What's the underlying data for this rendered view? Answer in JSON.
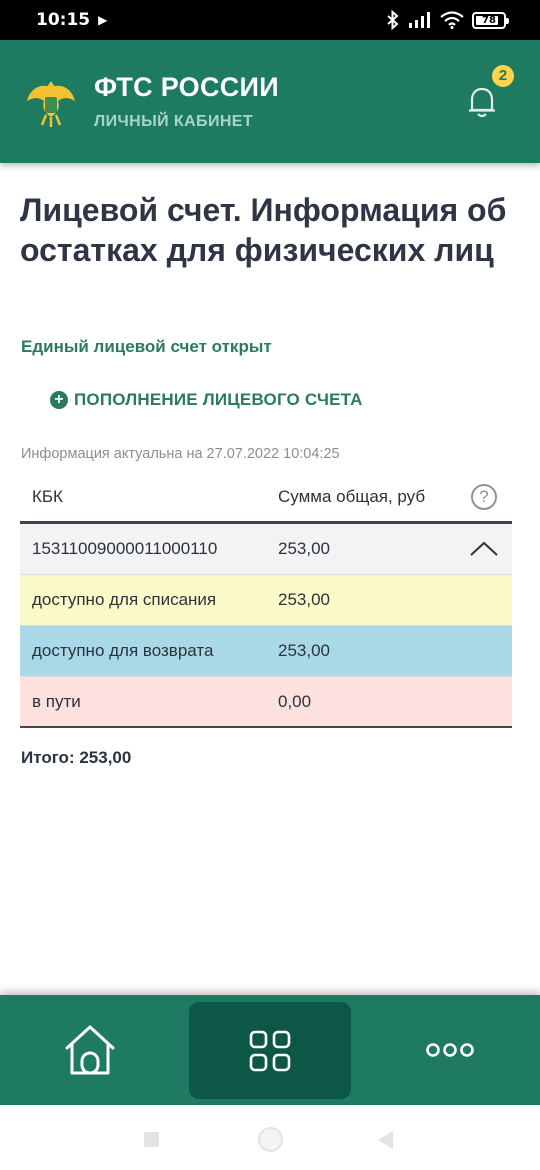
{
  "status_bar": {
    "time": "10:15",
    "battery": "78",
    "icons": [
      "play-icon",
      "bluetooth-icon",
      "signal-icon",
      "wifi-icon",
      "battery-icon"
    ]
  },
  "header": {
    "title": "ФТС РОССИИ",
    "subtitle": "ЛИЧНЫЙ КАБИНЕТ",
    "notification_count": "2",
    "colors": {
      "header_bg": "#1e7b62",
      "badge": "#ffd44a"
    }
  },
  "main": {
    "title": "Лицевой счет. Информация об остатках для физических лиц",
    "account_status": "Единый лицевой счет открыт",
    "topup_label": "ПОПОЛНЕНИЕ ЛИЦЕВОГО СЧЕТА",
    "info_date": "Информация актуальна на 27.07.2022 10:04:25",
    "table": {
      "headers": {
        "kbk": "КБК",
        "sum": "Сумма общая, руб"
      },
      "kbk_row": {
        "kbk": "15311009000011000110",
        "sum": "253,00"
      },
      "rows": [
        {
          "label": "доступно для списания",
          "value": "253,00",
          "color": "#fafac8"
        },
        {
          "label": "доступно для возврата",
          "value": "253,00",
          "color": "#a9d8e6"
        },
        {
          "label": "в пути",
          "value": "0,00",
          "color": "#fde1de"
        }
      ]
    },
    "total": "Итого: 253,00"
  },
  "bottom_nav": {
    "items": [
      "home-icon",
      "apps-grid-icon",
      "more-icon"
    ],
    "active": "apps-grid-icon"
  }
}
